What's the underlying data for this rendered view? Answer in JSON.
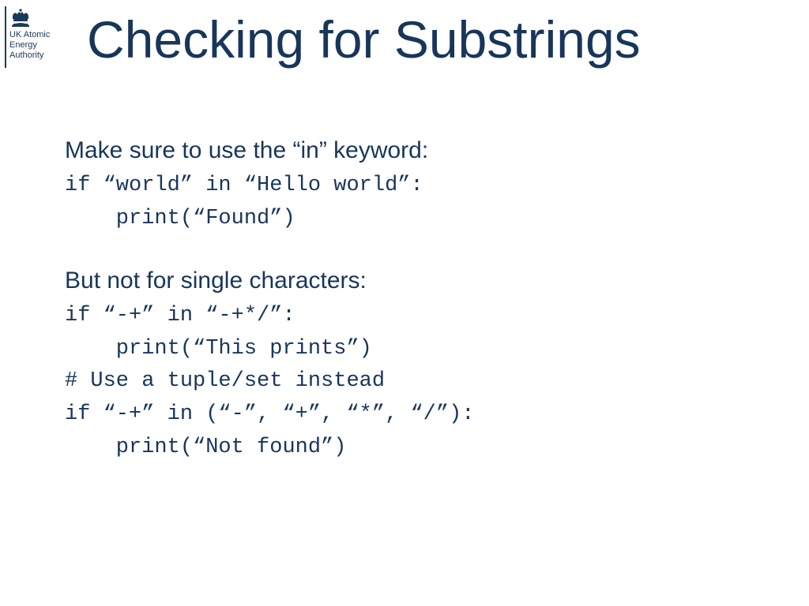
{
  "org": {
    "line1": "UK Atomic",
    "line2": "Energy",
    "line3": "Authority"
  },
  "title": "Checking for Substrings",
  "prose1": "Make sure to use the “in” keyword:",
  "code1a": "if “world” in “Hello world”:",
  "code1b": "    print(“Found”)",
  "prose2": "But not for single characters:",
  "code2a": "if “-+” in “-+*/”:",
  "code2b": "    print(“This prints”)",
  "code2c": "# Use a tuple/set instead",
  "code2d": "if “-+” in (“-”, “+”, “*”, “/”):",
  "code2e": "    print(“Not found”)"
}
